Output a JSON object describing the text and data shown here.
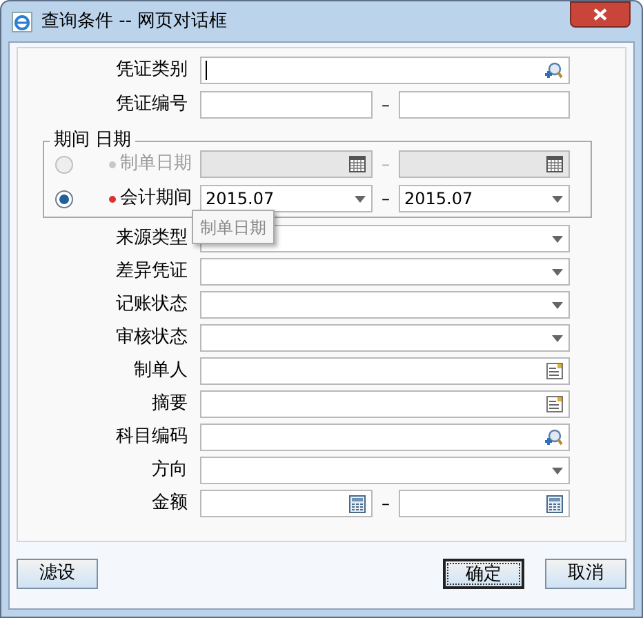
{
  "window": {
    "title": "查询条件 -- 网页对话框"
  },
  "fields_top": [
    {
      "label": "凭证类别",
      "kind": "lookup",
      "focused": true
    },
    {
      "label": "凭证编号",
      "kind": "text-range",
      "separator": "–"
    }
  ],
  "period_group": {
    "legend": "期间 日期",
    "tooltip": "制单日期",
    "options": [
      {
        "label": "制单日期",
        "required": true,
        "selected": false,
        "disabled": true,
        "kind": "date-range",
        "separator": "–"
      },
      {
        "label": "会计期间",
        "required": true,
        "selected": true,
        "disabled": false,
        "kind": "select-range",
        "separator": "–",
        "from": "2015.07",
        "to": "2015.07"
      }
    ]
  },
  "fields": [
    {
      "label": "来源类型",
      "kind": "select"
    },
    {
      "label": "差异凭证",
      "kind": "select"
    },
    {
      "label": "记账状态",
      "kind": "select"
    },
    {
      "label": "审核状态",
      "kind": "select"
    },
    {
      "label": "制单人",
      "kind": "memo"
    },
    {
      "label": "摘要",
      "kind": "memo"
    },
    {
      "label": "科目编码",
      "kind": "lookup"
    },
    {
      "label": "方向",
      "kind": "select"
    },
    {
      "label": "金额",
      "kind": "number-range",
      "separator": "–"
    }
  ],
  "buttons": [
    {
      "label": "滤设",
      "default": false
    },
    {
      "label": "确定",
      "default": true
    },
    {
      "label": "取消",
      "default": false
    }
  ]
}
